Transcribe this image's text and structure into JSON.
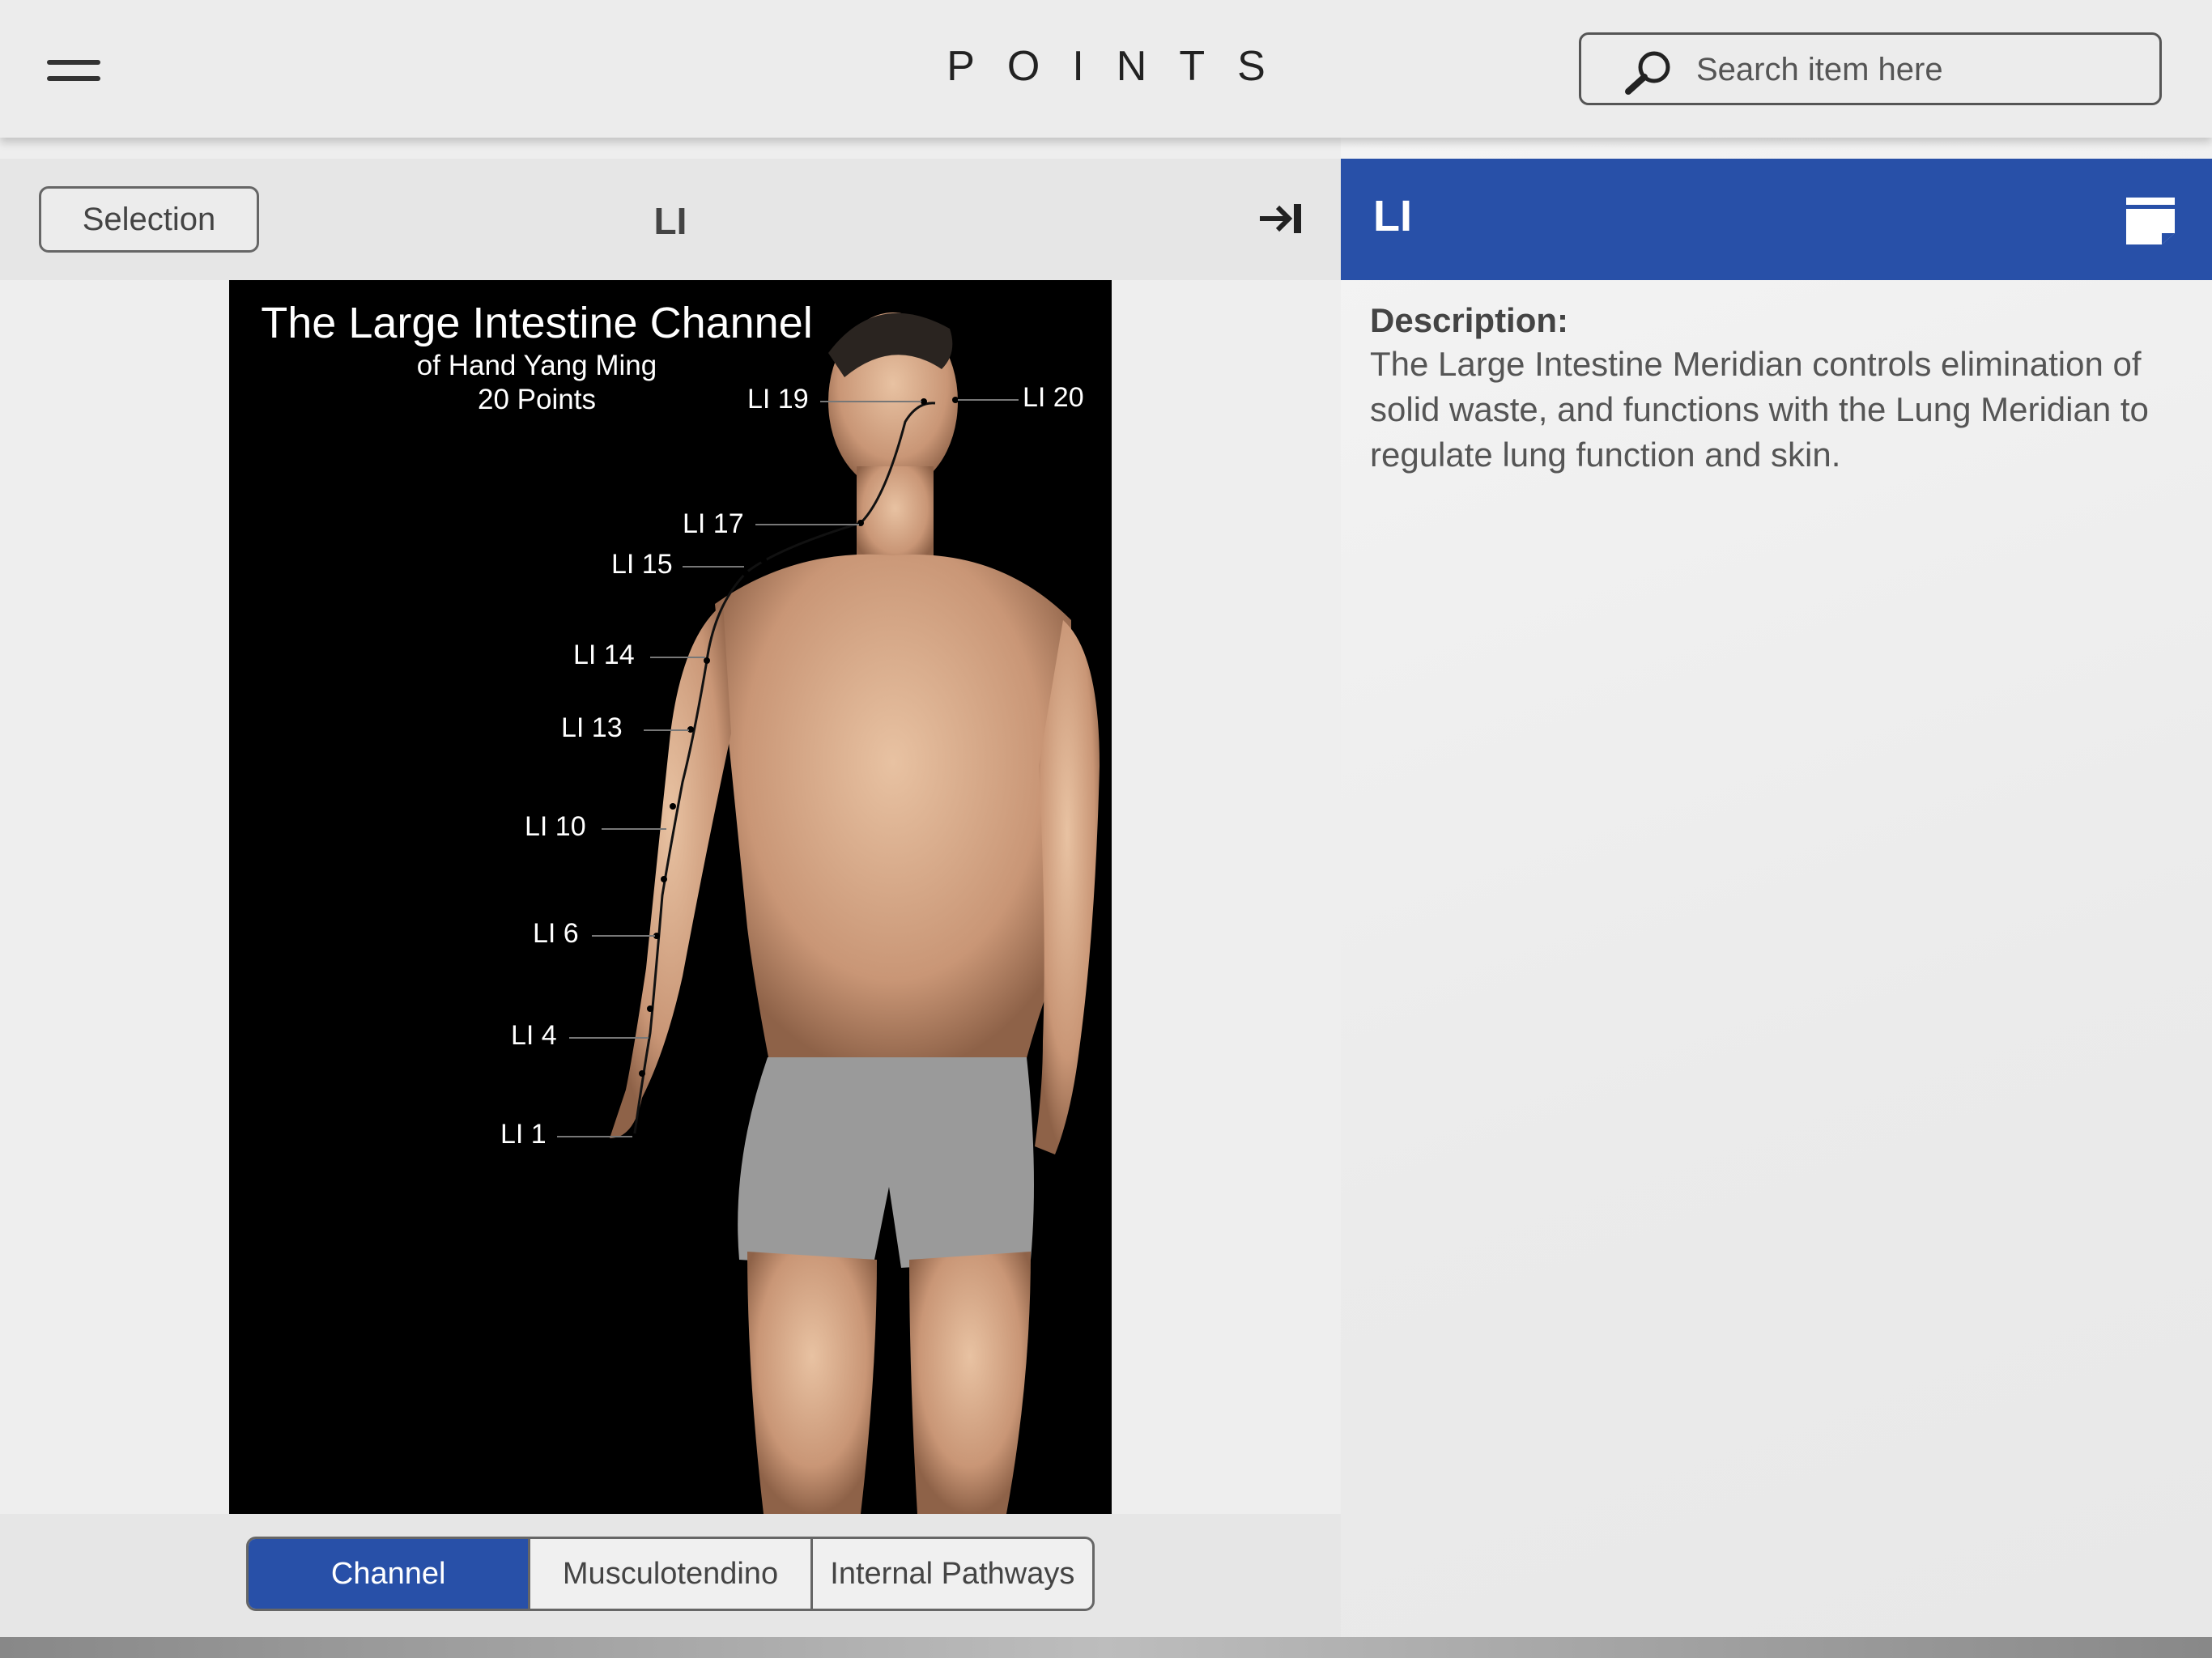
{
  "header": {
    "app_title": "POINTS",
    "search_placeholder": "Search item here"
  },
  "left": {
    "selection_label": "Selection",
    "title": "LI",
    "image": {
      "title": "The Large Intestine Channel",
      "subtitle": "of Hand Yang Ming",
      "count": "20 Points",
      "points": [
        "LI 20",
        "LI 19",
        "LI 17",
        "LI 15",
        "LI 14",
        "LI 13",
        "LI 10",
        "LI 6",
        "LI 4",
        "LI 1"
      ]
    },
    "tabs": [
      "Channel",
      "Musculotendino",
      "Internal Pathways"
    ],
    "active_tab": "Channel"
  },
  "right": {
    "title": "LI",
    "description_label": "Description:",
    "description": "The Large Intestine Meridian controls elimination of solid waste, and functions with the Lung Meridian to regulate lung function and skin."
  },
  "colors": {
    "accent": "#2850a8",
    "topbar": "#ececec",
    "text": "#333333"
  },
  "icons": [
    "hamburger-icon",
    "search-icon",
    "expand-right-icon",
    "note-icon"
  ]
}
